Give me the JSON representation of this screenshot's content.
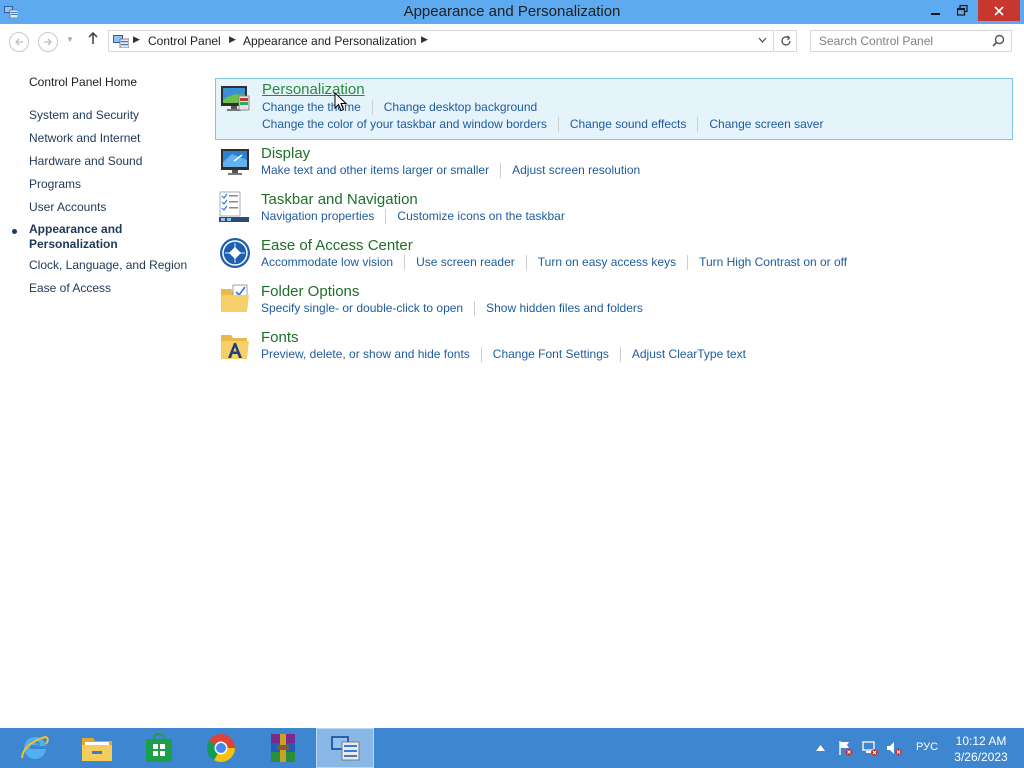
{
  "window": {
    "title": "Appearance and Personalization"
  },
  "nav": {
    "breadcrumb": [
      "Control Panel",
      "Appearance and Personalization"
    ],
    "search_placeholder": "Search Control Panel"
  },
  "sidebar": {
    "home": "Control Panel Home",
    "items": [
      {
        "label": "System and Security"
      },
      {
        "label": "Network and Internet"
      },
      {
        "label": "Hardware and Sound"
      },
      {
        "label": "Programs"
      },
      {
        "label": "User Accounts"
      },
      {
        "label": "Appearance and Personalization",
        "active": true
      },
      {
        "label": "Clock, Language, and Region"
      },
      {
        "label": "Ease of Access"
      }
    ]
  },
  "categories": [
    {
      "title": "Personalization",
      "icon": "personalization-icon",
      "rows": [
        [
          "Change the theme",
          "Change desktop background"
        ],
        [
          "Change the color of your taskbar and window borders",
          "Change sound effects",
          "Change screen saver"
        ]
      ]
    },
    {
      "title": "Display",
      "icon": "display-icon",
      "rows": [
        [
          "Make text and other items larger or smaller",
          "Adjust screen resolution"
        ]
      ]
    },
    {
      "title": "Taskbar and Navigation",
      "icon": "taskbar-icon",
      "rows": [
        [
          "Navigation properties",
          "Customize icons on the taskbar"
        ]
      ]
    },
    {
      "title": "Ease of Access Center",
      "icon": "ease-of-access-icon",
      "rows": [
        [
          "Accommodate low vision",
          "Use screen reader",
          "Turn on easy access keys",
          "Turn High Contrast on or off"
        ]
      ]
    },
    {
      "title": "Folder Options",
      "icon": "folder-options-icon",
      "rows": [
        [
          "Specify single- or double-click to open",
          "Show hidden files and folders"
        ]
      ]
    },
    {
      "title": "Fonts",
      "icon": "fonts-icon",
      "rows": [
        [
          "Preview, delete, or show and hide fonts",
          "Change Font Settings",
          "Adjust ClearType text"
        ]
      ]
    }
  ],
  "taskbar": {
    "apps": [
      "internet-explorer-icon",
      "file-explorer-icon",
      "store-icon",
      "chrome-icon",
      "winrar-icon",
      "control-panel-icon"
    ],
    "language": "РУС",
    "time": "10:12 AM",
    "date": "3/26/2023"
  }
}
